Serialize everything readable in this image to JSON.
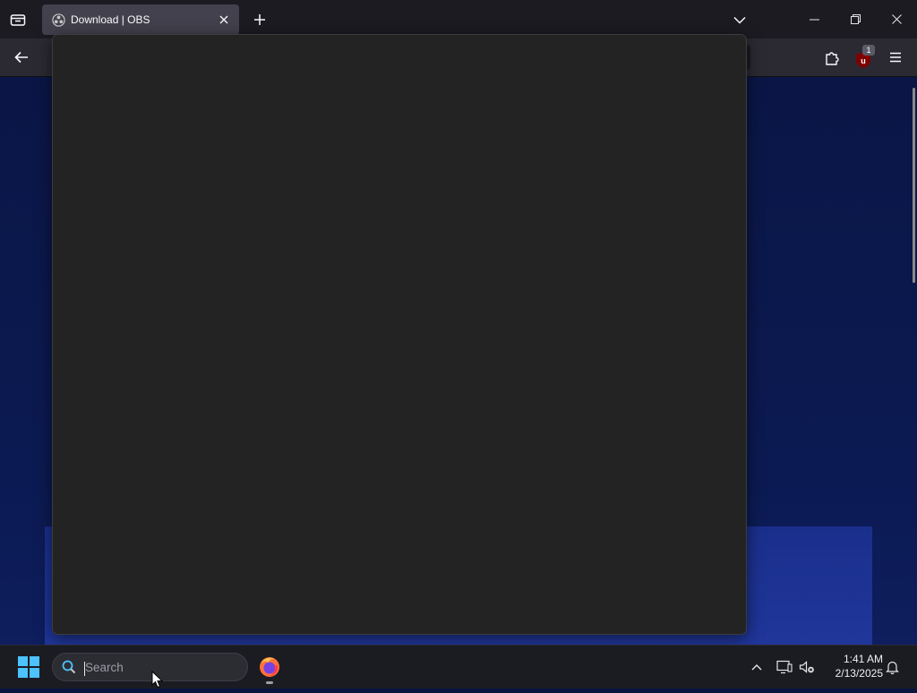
{
  "browser": {
    "tab": {
      "title": "Download | OBS"
    },
    "extension_badge": "1"
  },
  "taskbar": {
    "search_placeholder": "Search",
    "clock": {
      "time": "1:41 AM",
      "date": "2/13/2025"
    }
  },
  "icons": {
    "tab_overview": "tab-overview-icon",
    "new_tab": "plus-icon",
    "tab_list": "chevron-down-icon",
    "back": "arrow-left-icon",
    "extensions": "puzzle-icon",
    "ublock": "ublock-origin-icon",
    "menu": "hamburger-icon",
    "start": "windows-logo-icon",
    "firefox": "firefox-icon",
    "notifications": "bell-icon"
  },
  "colors": {
    "page_background": "#0a1540",
    "popup_background": "#232323",
    "accent_start": "#4cc2ff",
    "ublock_red": "#800000"
  }
}
